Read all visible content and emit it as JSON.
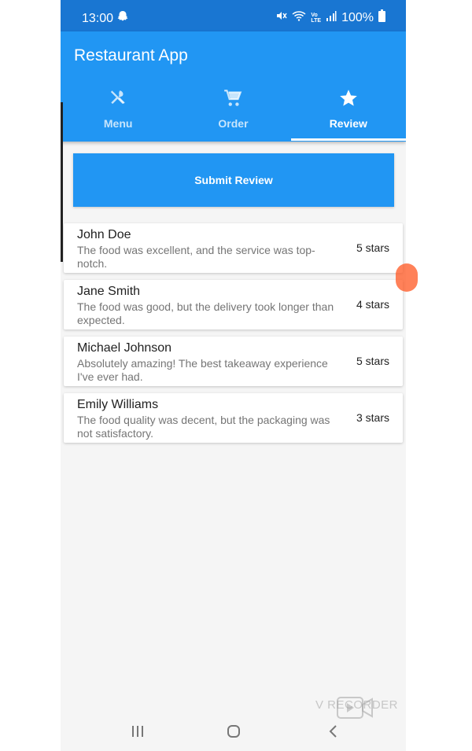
{
  "status_bar": {
    "time": "13:00",
    "battery": "100%",
    "icons": [
      "snapchat-ghost-icon",
      "mute-icon",
      "wifi-icon",
      "volte-icon",
      "signal-icon",
      "battery-icon"
    ]
  },
  "app_bar": {
    "title": "Restaurant App",
    "color": "#2196f3"
  },
  "tabs": [
    {
      "label": "Menu",
      "icon": "restaurant-icon",
      "active": false
    },
    {
      "label": "Order",
      "icon": "cart-icon",
      "active": false
    },
    {
      "label": "Review",
      "icon": "star-icon",
      "active": true
    }
  ],
  "submit_button": {
    "label": "Submit Review"
  },
  "reviews": [
    {
      "name": "John Doe",
      "text": "The food was excellent, and the service was top-notch.",
      "rating": "5 stars"
    },
    {
      "name": "Jane Smith",
      "text": "The food was good, but the delivery took longer than expected.",
      "rating": "4 stars"
    },
    {
      "name": "Michael Johnson",
      "text": "Absolutely amazing! The best takeaway experience I've ever had.",
      "rating": "5 stars"
    },
    {
      "name": "Emily Williams",
      "text": "The food quality was decent, but the packaging was not satisfactory.",
      "rating": "3 stars"
    }
  ],
  "nav_bar": {
    "icons": [
      "recent-apps-icon",
      "home-icon",
      "back-icon"
    ]
  },
  "watermark": {
    "text": "V RECORDER"
  }
}
